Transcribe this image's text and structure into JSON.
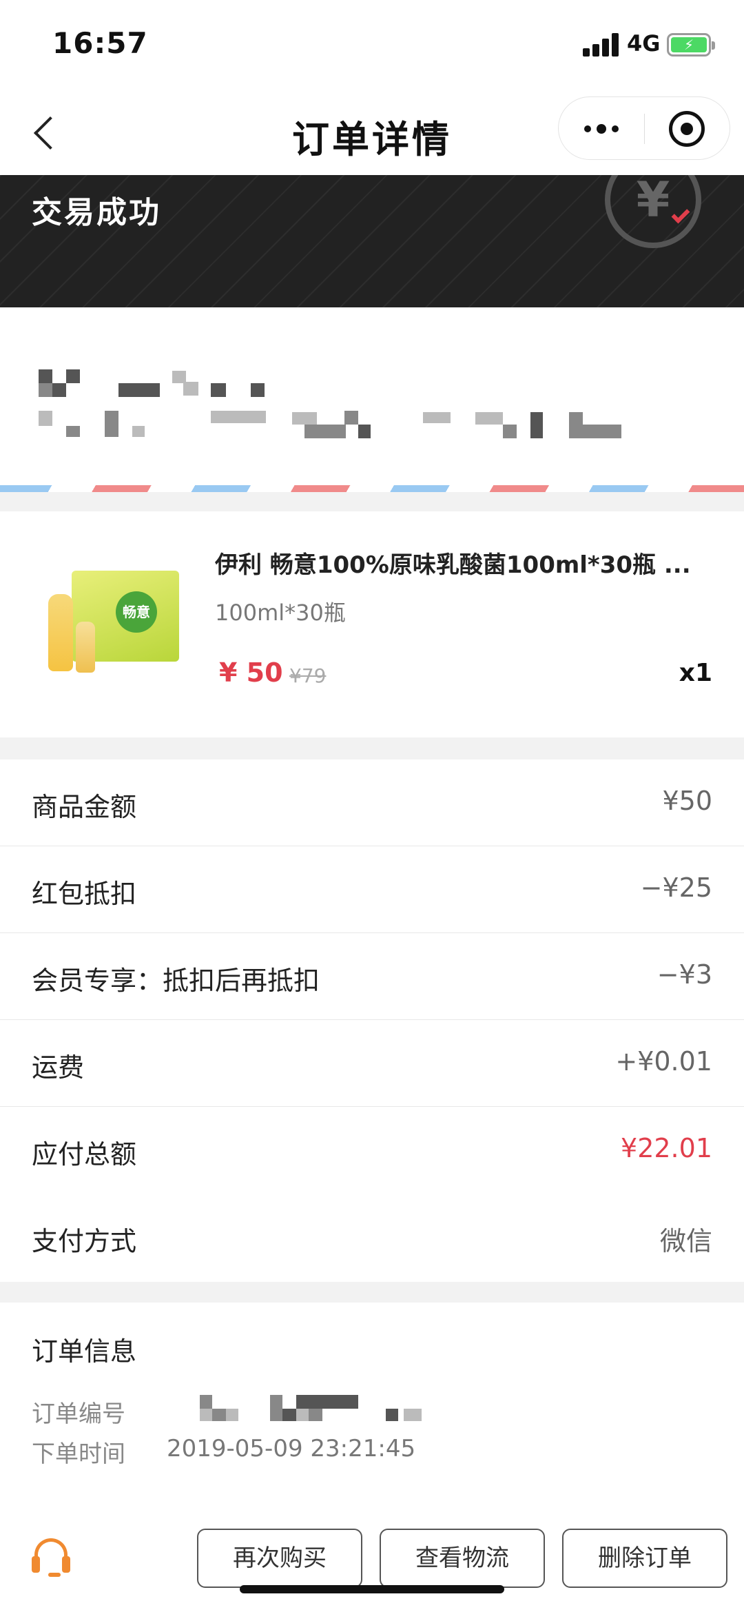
{
  "status_bar": {
    "time": "16:57",
    "network": "4G"
  },
  "nav": {
    "title": "订单详情"
  },
  "banner": {
    "status": "交易成功",
    "stamp_char": "¥"
  },
  "product": {
    "title": "伊利 畅意100%原味乳酸菌100ml*30瓶 ...",
    "spec": "100ml*30瓶",
    "price": "¥ 50",
    "original_price": "¥79",
    "quantity": "x1",
    "image_logo": "畅意"
  },
  "summary": {
    "rows": [
      {
        "label": "商品金额",
        "value": "¥50"
      },
      {
        "label": "红包抵扣",
        "value": "−¥25"
      },
      {
        "label": "会员专享：抵扣后再抵扣",
        "value": "−¥3"
      },
      {
        "label": "运费",
        "value": "+¥0.01"
      },
      {
        "label": "应付总额",
        "value": "¥22.01",
        "highlight": "#e13e4b"
      },
      {
        "label": "支付方式",
        "value": "微信"
      }
    ]
  },
  "order_info": {
    "title": "订单信息",
    "order_no_label": "订单编号",
    "order_time_label": "下单时间",
    "order_time": "2019-05-09 23:21:45"
  },
  "footer": {
    "buttons": [
      "再次购买",
      "查看物流",
      "删除订单"
    ]
  },
  "colors": {
    "accent": "#e13e4b",
    "service": "#f08a30",
    "banner_bg": "#222222"
  }
}
